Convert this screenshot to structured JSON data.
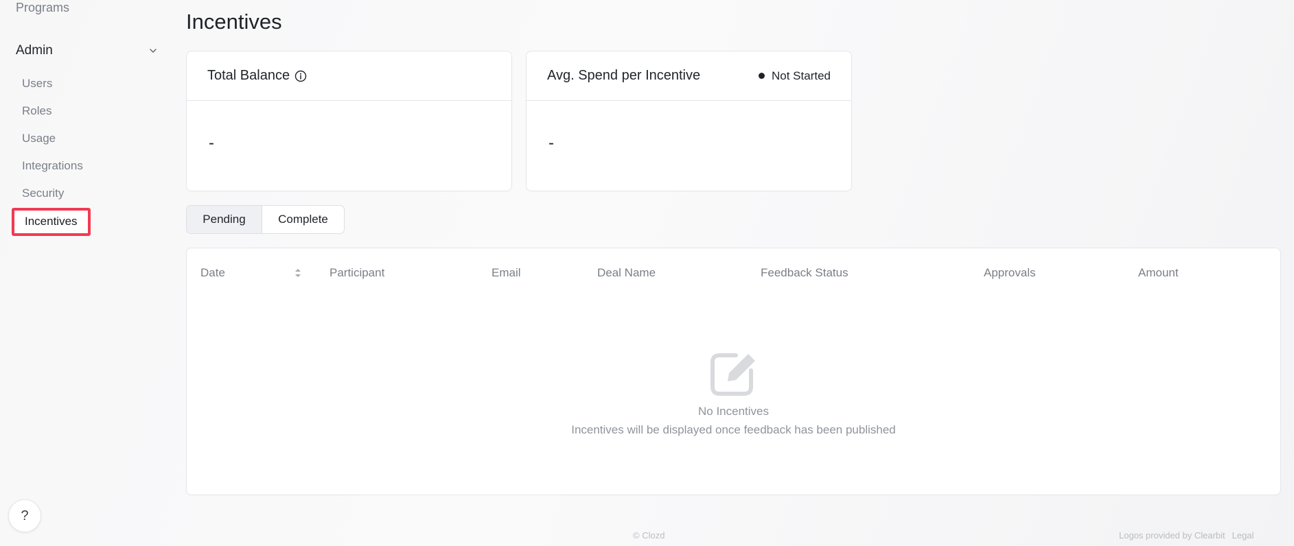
{
  "sidebar": {
    "programs_label": "Programs",
    "admin_label": "Admin",
    "items": [
      {
        "label": "Users"
      },
      {
        "label": "Roles"
      },
      {
        "label": "Usage"
      },
      {
        "label": "Integrations"
      },
      {
        "label": "Security"
      },
      {
        "label": "Incentives",
        "active": true
      }
    ],
    "help_label": "?"
  },
  "page": {
    "title": "Incentives"
  },
  "cards": {
    "total_balance": {
      "title": "Total Balance",
      "value": "-",
      "icon": "info-icon"
    },
    "avg_spend": {
      "title": "Avg. Spend per Incentive",
      "status": "Not Started",
      "value": "-"
    }
  },
  "tabs": [
    {
      "label": "Pending",
      "selected": true
    },
    {
      "label": "Complete",
      "selected": false
    }
  ],
  "table": {
    "columns": [
      "Date",
      "Participant",
      "Email",
      "Deal Name",
      "Feedback Status",
      "Approvals",
      "Amount"
    ],
    "rows": [],
    "empty": {
      "icon": "edit-icon",
      "title": "No Incentives",
      "subtitle": "Incentives will be displayed once feedback has been published"
    }
  },
  "footer": {
    "copyright": "© Clozd",
    "logos_credit": "Logos provided by Clearbit",
    "legal": "Legal"
  },
  "colors": {
    "active_outline": "#f23a52",
    "muted_text": "#7a7f87",
    "border": "#e3e5e9"
  }
}
